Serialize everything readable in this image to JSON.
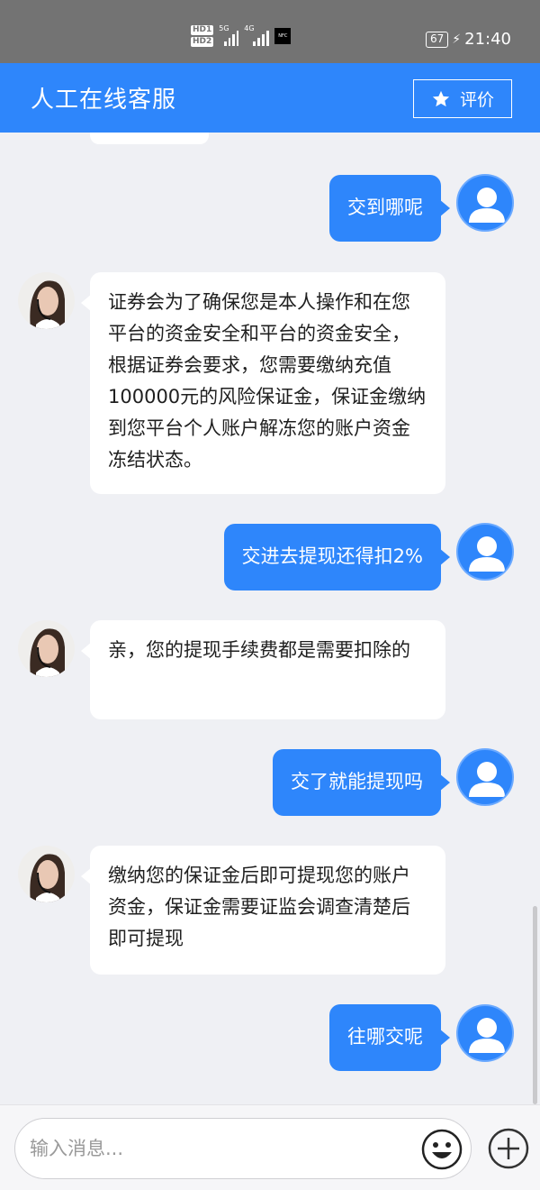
{
  "status_bar": {
    "hd1": "HD1",
    "hd2": "HD2",
    "sig1_label": "5G",
    "sig2_label": "4G",
    "nfc_label": "NFC",
    "battery": "67",
    "time": "21:40"
  },
  "header": {
    "title": "人工在线客服",
    "rate_label": "评价",
    "accent_color": "#2e86fb"
  },
  "messages": [
    {
      "side": "out",
      "text": "交到哪呢"
    },
    {
      "side": "in",
      "text": "证券会为了确保您是本人操作和在您平台的资金安全和平台的资金安全，根据证券会要求，您需要缴纳充值100000元的风险保证金，保证金缴纳到您平台个人账户解冻您的账户资金冻结状态。"
    },
    {
      "side": "out",
      "text": "交进去提现还得扣2%"
    },
    {
      "side": "in",
      "text": "亲，您的提现手续费都是需要扣除的"
    },
    {
      "side": "out",
      "text": "交了就能提现吗"
    },
    {
      "side": "in",
      "text": "缴纳您的保证金后即可提现您的账户资金，保证金需要证监会调查清楚后即可提现"
    },
    {
      "side": "out",
      "text": "往哪交呢"
    }
  ],
  "input": {
    "placeholder": "输入消息..."
  },
  "icons": {
    "rate": "star-icon",
    "emoji": "smiley-icon",
    "plus": "plus-circle-icon",
    "user_avatar": "user-avatar-icon",
    "agent_avatar": "agent-avatar-icon"
  }
}
